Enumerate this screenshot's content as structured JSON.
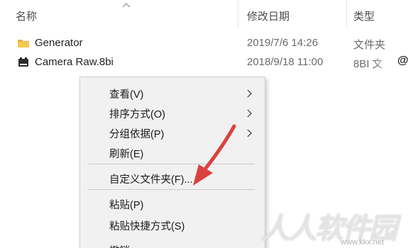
{
  "header": {
    "col_name": "名称",
    "col_date": "修改日期",
    "col_type": "类型"
  },
  "files": [
    {
      "name": "Generator",
      "date": "2019/7/6 14:26",
      "type": "文件夹",
      "icon": "folder-icon"
    },
    {
      "name": "Camera Raw.8bi",
      "date": "2018/9/18 11:00",
      "type": "8BI 文",
      "icon": "plugin-file-icon"
    }
  ],
  "context_menu": {
    "items": [
      {
        "label": "查看(V)",
        "submenu": true
      },
      {
        "label": "排序方式(O)",
        "submenu": true
      },
      {
        "label": "分组依据(P)",
        "submenu": true
      },
      {
        "label": "刷新(E)",
        "submenu": false
      },
      {
        "label": "自定义文件夹(F)...",
        "submenu": false
      },
      {
        "label": "粘贴(P)",
        "submenu": false,
        "highlighted": true
      },
      {
        "label": "粘贴快捷方式(S)",
        "submenu": false
      },
      {
        "label": "撤销 ",
        "submenu": false
      }
    ]
  },
  "watermark": {
    "text": "人人软件园",
    "url": "www.kkx.net"
  },
  "colors": {
    "highlight_border": "#d9423f",
    "arrow": "#d9423f",
    "folder": "#e8b33c",
    "menu_background": "#f1f1f1"
  }
}
